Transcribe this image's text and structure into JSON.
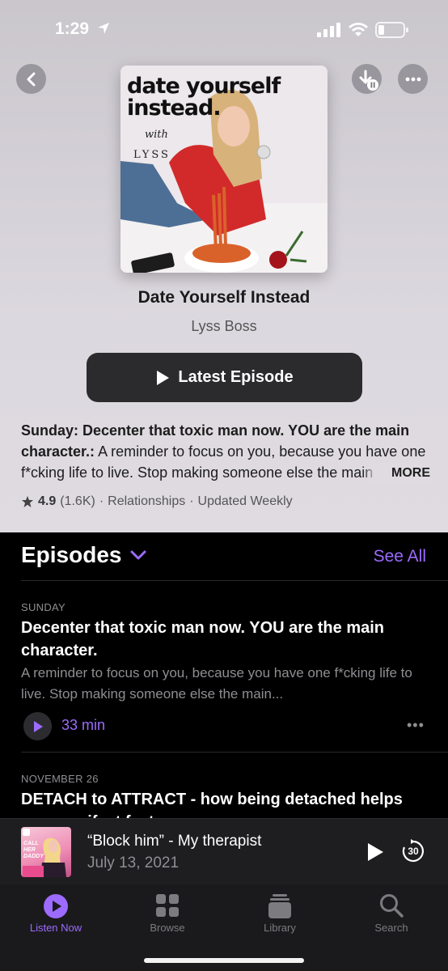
{
  "status_bar": {
    "time": "1:29"
  },
  "podcast": {
    "artwork_title": "date yourself instead.",
    "artwork_with": "with",
    "artwork_name": "LYSS",
    "title": "Date Yourself Instead",
    "author": "Lyss Boss",
    "latest_button_label": "Latest Episode",
    "description_bold": "Sunday: Decenter that toxic man now. YOU are the main character.:",
    "description_rest": " A reminder to focus on you, because you have one f*cking life to live. Stop making someone else the main character.",
    "more_label": "MORE",
    "rating": "4.9",
    "rating_count": "(1.6K)",
    "category": "Relationships",
    "frequency": "Updated Weekly",
    "separator": "·"
  },
  "episodes": {
    "header": "Episodes",
    "see_all": "See All",
    "items": [
      {
        "date": "SUNDAY",
        "title": "Decenter that toxic man now. YOU are the main character.",
        "description": "A reminder to focus on you, because you have one f*cking life to live. Stop making someone else the main...",
        "duration": "33 min"
      },
      {
        "date": "NOVEMBER 26",
        "title": "DETACH to ATTRACT - how being detached helps you manifest faster"
      }
    ]
  },
  "mini_player": {
    "title": "“Block him” - My therapist",
    "date": "July 13, 2021",
    "art_text": "CALL HER DADDY",
    "skip_seconds": "30"
  },
  "tabs": [
    {
      "label": "Listen Now",
      "icon": "play-circle-icon",
      "active": true
    },
    {
      "label": "Browse",
      "icon": "grid-icon",
      "active": false
    },
    {
      "label": "Library",
      "icon": "library-stack-icon",
      "active": false
    },
    {
      "label": "Search",
      "icon": "search-icon",
      "active": false
    }
  ],
  "colors": {
    "accent": "#9d6bff",
    "background_dark": "#000000",
    "header_gradient": "#d3cfd6"
  }
}
